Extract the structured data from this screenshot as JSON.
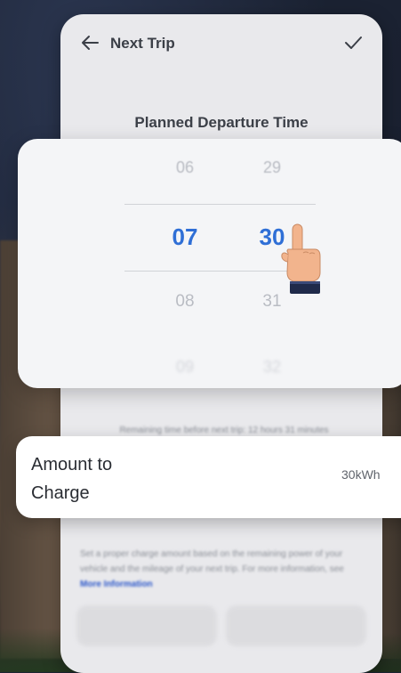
{
  "header": {
    "title": "Next Trip",
    "back_icon": "arrow-left-icon",
    "confirm_icon": "checkmark-icon"
  },
  "section": {
    "title": "Planned Departure Time"
  },
  "picker": {
    "hours": [
      "06",
      "07",
      "08",
      "09"
    ],
    "minutes": [
      "29",
      "30",
      "31",
      "32"
    ],
    "selected_hour": "07",
    "selected_minute": "30",
    "accent_color": "#2f6fd6"
  },
  "remaining_text": "Remaining time before next trip: 12 hours 31 minutes",
  "amount": {
    "label": "Amount to Charge",
    "value": "30kWh"
  },
  "info": {
    "text": "Set a proper charge amount based on the remaining power of your vehicle and the mileage of your next trip. For more information, see",
    "link": "More Information"
  }
}
